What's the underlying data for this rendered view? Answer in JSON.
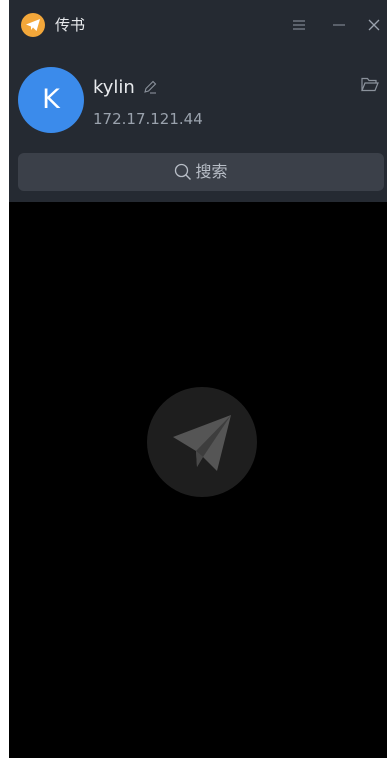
{
  "app": {
    "title": "传书",
    "accent_color": "#f3a73a",
    "icons": {
      "logo": "paper-plane-icon",
      "menu": "menu-icon",
      "minimize": "minimize-icon",
      "close": "close-icon"
    }
  },
  "profile": {
    "avatar_letter": "K",
    "avatar_color": "#3b8beb",
    "username": "kylin",
    "ip_address": "172.17.121.44",
    "icons": {
      "edit": "edit-pencil-icon",
      "folder": "folder-icon"
    }
  },
  "search": {
    "label": "搜索",
    "icon": "search-icon"
  },
  "main": {
    "empty_icon": "paper-plane-icon",
    "background_color": "#000000"
  }
}
